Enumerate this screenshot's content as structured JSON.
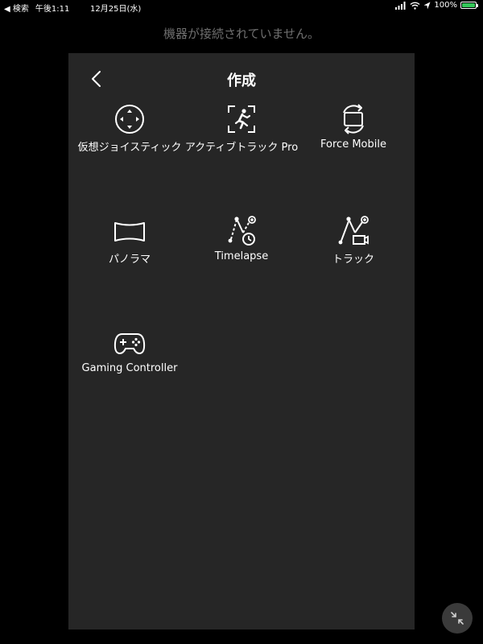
{
  "status_bar": {
    "back_app": "◀ 検索",
    "time": "午後1:11",
    "date": "12月25日(水)",
    "battery_percent": "100%",
    "battery_level": 1.0,
    "battery_color": "#34c759"
  },
  "device_message": "機器が接続されていません。",
  "panel": {
    "title": "作成",
    "items": [
      {
        "label": "仮想ジョイスティック",
        "icon": "joystick-icon"
      },
      {
        "label": "アクティブトラック Pro",
        "icon": "active-track-icon"
      },
      {
        "label": "Force Mobile",
        "icon": "force-mobile-icon"
      },
      {
        "label": "パノラマ",
        "icon": "panorama-icon"
      },
      {
        "label": "Timelapse",
        "icon": "timelapse-icon"
      },
      {
        "label": "トラック",
        "icon": "track-icon"
      },
      {
        "label": "Gaming Controller",
        "icon": "gamepad-icon"
      }
    ]
  },
  "colors": {
    "background": "#000000",
    "panel": "#262626",
    "muted_text": "#6f6f6f",
    "text": "#ffffff"
  }
}
